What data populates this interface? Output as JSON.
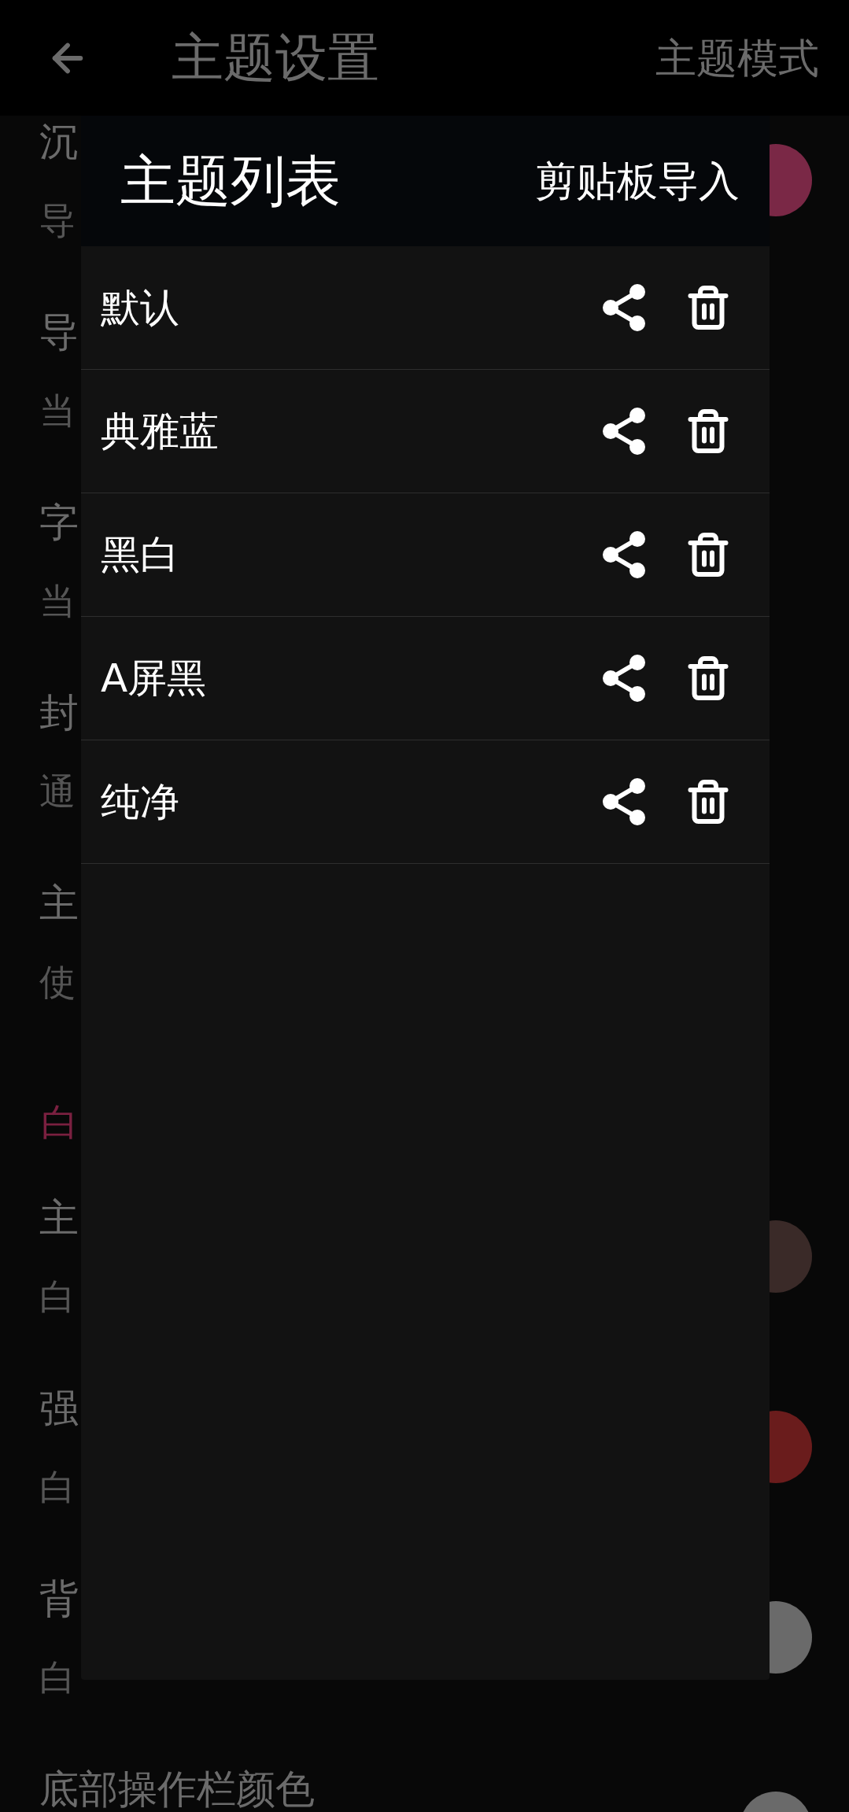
{
  "app_bar": {
    "title": "主题设置",
    "action": "主题模式"
  },
  "settings": [
    {
      "kind": "setting",
      "title": "沉",
      "subtitle": "导",
      "color": "#7a2846"
    },
    {
      "kind": "setting",
      "title": "导",
      "subtitle": "当"
    },
    {
      "kind": "setting",
      "title": "字",
      "subtitle": "当"
    },
    {
      "kind": "setting",
      "title": "封",
      "subtitle": "通"
    },
    {
      "kind": "setting",
      "title": "主",
      "subtitle": "使"
    },
    {
      "kind": "section",
      "title": "白"
    },
    {
      "kind": "setting",
      "title": "主",
      "subtitle": "白",
      "color": "#3a2a28"
    },
    {
      "kind": "setting",
      "title": "强",
      "subtitle": "白",
      "color": "#6a1c1c"
    },
    {
      "kind": "setting",
      "title": "背",
      "subtitle": "白",
      "color": "#6a6a6a"
    },
    {
      "kind": "setting",
      "title": "底部操作栏颜色",
      "color": "#6a6a6a"
    }
  ],
  "dialog": {
    "title": "主题列表",
    "action": "剪贴板导入",
    "themes": [
      {
        "name": "默认"
      },
      {
        "name": "典雅蓝"
      },
      {
        "name": "黑白"
      },
      {
        "name": "A屏黑"
      },
      {
        "name": "纯净"
      }
    ]
  }
}
